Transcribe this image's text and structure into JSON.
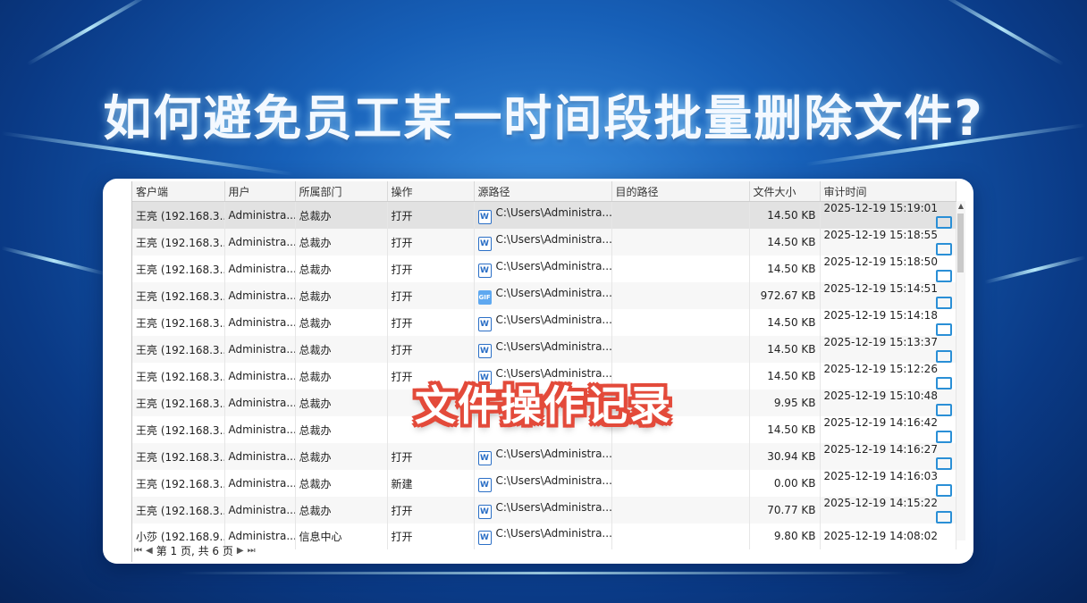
{
  "headline": "如何避免员工某一时间段批量删除文件?",
  "overlay_caption": "文件操作记录",
  "table": {
    "columns": [
      "客户端",
      "用户",
      "所属部门",
      "操作",
      "源路径",
      "目的路径",
      "文件大小",
      "审计时间"
    ],
    "rows": [
      {
        "client": "王亮 (192.168.3...",
        "user": "Administra...",
        "dept": "总裁办",
        "op": "打开",
        "icon": "word-file-icon",
        "src": "C:\\Users\\Administra...",
        "dst": "",
        "size": "14.50 KB",
        "time": "2025-12-19 15:19:01",
        "screen": true
      },
      {
        "client": "王亮 (192.168.3...",
        "user": "Administra...",
        "dept": "总裁办",
        "op": "打开",
        "icon": "word-file-icon",
        "src": "C:\\Users\\Administra...",
        "dst": "",
        "size": "14.50 KB",
        "time": "2025-12-19 15:18:55",
        "screen": true
      },
      {
        "client": "王亮 (192.168.3...",
        "user": "Administra...",
        "dept": "总裁办",
        "op": "打开",
        "icon": "word-file-icon",
        "src": "C:\\Users\\Administra...",
        "dst": "",
        "size": "14.50 KB",
        "time": "2025-12-19 15:18:50",
        "screen": true
      },
      {
        "client": "王亮 (192.168.3...",
        "user": "Administra...",
        "dept": "总裁办",
        "op": "打开",
        "icon": "gif-file-icon",
        "src": "C:\\Users\\Administra...",
        "dst": "",
        "size": "972.67 KB",
        "time": "2025-12-19 15:14:51",
        "screen": true
      },
      {
        "client": "王亮 (192.168.3...",
        "user": "Administra...",
        "dept": "总裁办",
        "op": "打开",
        "icon": "word-file-icon",
        "src": "C:\\Users\\Administra...",
        "dst": "",
        "size": "14.50 KB",
        "time": "2025-12-19 15:14:18",
        "screen": true
      },
      {
        "client": "王亮 (192.168.3...",
        "user": "Administra...",
        "dept": "总裁办",
        "op": "打开",
        "icon": "word-file-icon",
        "src": "C:\\Users\\Administra...",
        "dst": "",
        "size": "14.50 KB",
        "time": "2025-12-19 15:13:37",
        "screen": true
      },
      {
        "client": "王亮 (192.168.3...",
        "user": "Administra...",
        "dept": "总裁办",
        "op": "打开",
        "icon": "word-file-icon",
        "src": "C:\\Users\\Administra...",
        "dst": "",
        "size": "14.50 KB",
        "time": "2025-12-19 15:12:26",
        "screen": true
      },
      {
        "client": "王亮 (192.168.3...",
        "user": "Administra...",
        "dept": "总裁办",
        "op": "",
        "icon": "",
        "src": "",
        "dst": "",
        "size": "9.95 KB",
        "time": "2025-12-19 15:10:48",
        "screen": true
      },
      {
        "client": "王亮 (192.168.3...",
        "user": "Administra...",
        "dept": "总裁办",
        "op": "",
        "icon": "",
        "src": "",
        "dst": "",
        "size": "14.50 KB",
        "time": "2025-12-19 14:16:42",
        "screen": true
      },
      {
        "client": "王亮 (192.168.3...",
        "user": "Administra...",
        "dept": "总裁办",
        "op": "打开",
        "icon": "word-file-icon",
        "src": "C:\\Users\\Administra...",
        "dst": "",
        "size": "30.94 KB",
        "time": "2025-12-19 14:16:27",
        "screen": true
      },
      {
        "client": "王亮 (192.168.3...",
        "user": "Administra...",
        "dept": "总裁办",
        "op": "新建",
        "icon": "word-file-icon",
        "src": "C:\\Users\\Administra...",
        "dst": "",
        "size": "0.00 KB",
        "time": "2025-12-19 14:16:03",
        "screen": true
      },
      {
        "client": "王亮 (192.168.3...",
        "user": "Administra...",
        "dept": "总裁办",
        "op": "打开",
        "icon": "word-file-icon",
        "src": "C:\\Users\\Administra...",
        "dst": "",
        "size": "70.77 KB",
        "time": "2025-12-19 14:15:22",
        "screen": true
      },
      {
        "client": "小莎 (192.168.9...",
        "user": "Administra...",
        "dept": "信息中心",
        "op": "打开",
        "icon": "word-file-icon",
        "src": "C:\\Users\\Administra...",
        "dst": "",
        "size": "9.80 KB",
        "time": "2025-12-19 14:08:02",
        "screen": false
      }
    ],
    "selected_row": 0
  },
  "pager": {
    "text": "第 1 页, 共 6 页"
  },
  "colors": {
    "accent": "#2a8fd6",
    "caption_outline": "#e34a3a"
  }
}
